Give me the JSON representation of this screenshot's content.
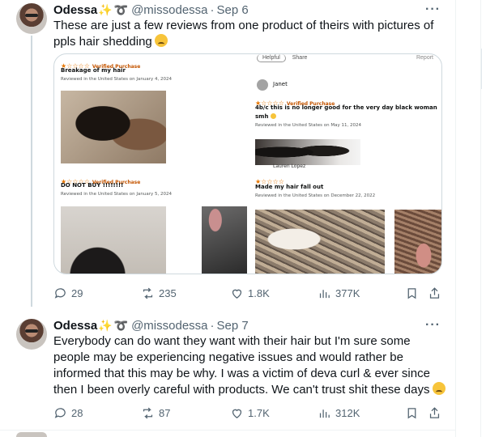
{
  "tweets": [
    {
      "display_name": "Odessa",
      "decor": "✨",
      "decor2": "➰",
      "handle": "@missodessa",
      "date": "Sep 6",
      "text": "These are just a few reviews from one product of theirs with pictures of ppls hair shedding",
      "emoji": "worried-face",
      "media": {
        "pill_helpful": "Helpful",
        "pill_share": "Share",
        "report": "Report",
        "reviews": [
          {
            "stars": "★☆☆☆☆",
            "verified": "Verified Purchase",
            "title": "Breakage of my hair",
            "date": "Reviewed in the United States on January 4, 2024"
          },
          {
            "reviewer": "Janet",
            "stars": "★☆☆☆☆",
            "verified": "Verified Purchase",
            "title_line1": "4b/c this is no longer good for the very day black woman",
            "title_line2": "smh",
            "date": "Reviewed in the United States on May 11, 2024"
          },
          {
            "reviewer": "Lauren Lopez",
            "stars": "★☆☆☆☆",
            "verified": "Verified Purchase",
            "title": "DO NOT BUY !!!!!!!!",
            "date": "Reviewed in the United States on January 5, 2024"
          },
          {
            "stars": "★☆☆☆☆",
            "title": "Made my hair fall out",
            "date": "Reviewed in the United States on December 22, 2022"
          }
        ]
      },
      "replies": "29",
      "reposts": "235",
      "likes": "1.8K",
      "views": "377K"
    },
    {
      "display_name": "Odessa",
      "decor": "✨",
      "decor2": "➰",
      "handle": "@missodessa",
      "date": "Sep 7",
      "text": "Everybody can do want they want with their hair but I'm sure some people may be experiencing negative issues and would rather be informed that this may be why. I was a victim of deva curl & ever since then I been overly careful with products. We can't trust shit these days",
      "emoji": "weary-face",
      "replies": "28",
      "reposts": "87",
      "likes": "1.7K",
      "views": "312K"
    }
  ],
  "colors": {
    "text_primary": "#0f1419",
    "text_secondary": "#536471",
    "thread_line": "#cfd9de",
    "star": "#e77600"
  }
}
